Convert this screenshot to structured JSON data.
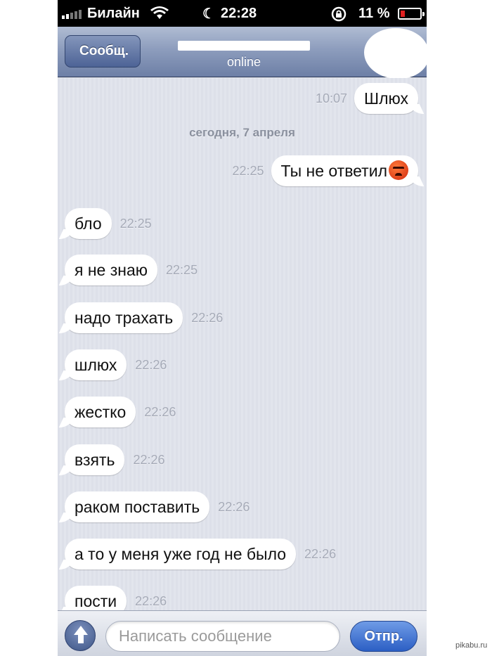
{
  "status_bar": {
    "carrier": "Билайн",
    "time": "22:28",
    "battery_percent": "11 %",
    "battery_level": 0.11,
    "icons": [
      "signal-icon",
      "wifi-icon",
      "moon-icon",
      "rotation-lock-icon",
      "battery-icon"
    ]
  },
  "nav": {
    "back_label": "Сообщ.",
    "subtitle": "online"
  },
  "chat": {
    "date_separator": "сегодня, 7 апреля",
    "messages": [
      {
        "side": "out",
        "text": "Шлюх",
        "time": "10:07"
      },
      {
        "side": "out",
        "text": "Ты не ответил",
        "time": "22:25",
        "emoji": "angry-face"
      },
      {
        "side": "in",
        "text": "бло",
        "time": "22:25"
      },
      {
        "side": "in",
        "text": "я не знаю",
        "time": "22:25"
      },
      {
        "side": "in",
        "text": "надо трахать",
        "time": "22:26"
      },
      {
        "side": "in",
        "text": "шлюх",
        "time": "22:26"
      },
      {
        "side": "in",
        "text": "жестко",
        "time": "22:26"
      },
      {
        "side": "in",
        "text": "взять",
        "time": "22:26"
      },
      {
        "side": "in",
        "text": "раком поставить",
        "time": "22:26"
      },
      {
        "side": "in",
        "text": "а то у меня уже год не было",
        "time": "22:26"
      },
      {
        "side": "in",
        "text": "пости",
        "time": "22:26"
      }
    ]
  },
  "input_bar": {
    "placeholder": "Написать сообщение",
    "send_label": "Отпр."
  },
  "watermark": "pikabu.ru",
  "colors": {
    "nav_bar": "#8d9dbd",
    "chat_background": "#dfe2ea",
    "bubble": "#ffffff",
    "send_button": "#2c5fc4"
  }
}
